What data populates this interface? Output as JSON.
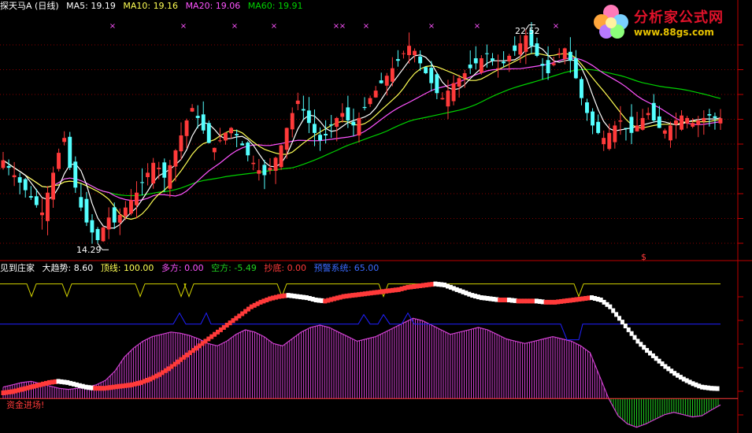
{
  "header": {
    "stock_name": "探天马A (日线)",
    "ma5_label": "MA5:",
    "ma5_value": "19.19",
    "ma10_label": "MA10:",
    "ma10_value": "19.16",
    "ma20_label": "MA20:",
    "ma20_value": "19.06",
    "ma60_label": "MA60:",
    "ma60_value": "19.91"
  },
  "watermark": {
    "cn": "分析家公式网",
    "url": "www.88gs.com"
  },
  "price_panel": {
    "high_label": "22.52",
    "low_label": "14.29",
    "dollar_marker": "$"
  },
  "indicator_header": {
    "name": "见到庄家",
    "trend_label": "大趋势:",
    "trend_value": "8.60",
    "top_label": "顶线:",
    "top_value": "100.00",
    "long_label": "多方:",
    "long_value": "0.00",
    "short_label": "空方:",
    "short_value": "-5.49",
    "bottom_label": "抄底:",
    "bottom_value": "0.00",
    "warn_label": "预警系统:",
    "warn_value": "65.00"
  },
  "indicator_panel": {
    "signal_text": "资金进场!"
  },
  "colors": {
    "up": "#ff3a3a",
    "down": "#54ffff",
    "ma5": "#ffffff",
    "ma10": "#ffff54",
    "ma20": "#ff54ff",
    "ma60": "#00d200",
    "grid": "#c00000",
    "warn": "#2020ff",
    "top": "#d4d400",
    "fund": "#d040d0",
    "neg": "#20d020"
  },
  "chart_data": [
    {
      "type": "candlestick",
      "title": "探天马A (日线)",
      "series": [
        {
          "name": "MA5",
          "last": 19.19
        },
        {
          "name": "MA10",
          "last": 19.16
        },
        {
          "name": "MA20",
          "last": 19.06
        },
        {
          "name": "MA60",
          "last": 19.91
        }
      ],
      "close_path": [
        17.5,
        17.2,
        16.9,
        16.6,
        16.3,
        16.0,
        15.7,
        15.4,
        16.2,
        17.0,
        17.8,
        18.4,
        17.2,
        16.4,
        15.6,
        15.0,
        14.6,
        14.29,
        14.8,
        15.2,
        15.0,
        15.3,
        15.6,
        15.9,
        16.2,
        16.6,
        17.0,
        17.4,
        17.2,
        16.8,
        17.3,
        17.9,
        18.5,
        19.1,
        19.6,
        19.2,
        18.7,
        18.2,
        18.0,
        18.3,
        18.6,
        18.8,
        18.5,
        18.1,
        17.7,
        17.4,
        17.1,
        16.9,
        17.2,
        17.6,
        18.1,
        18.8,
        19.4,
        19.9,
        19.5,
        19.0,
        18.6,
        18.3,
        18.5,
        18.9,
        19.2,
        19.4,
        19.1,
        18.9,
        19.2,
        19.6,
        20.0,
        20.3,
        20.6,
        20.9,
        21.2,
        21.5,
        21.8,
        22.1,
        21.9,
        21.4,
        21.0,
        20.6,
        20.2,
        20.0,
        20.3,
        20.6,
        20.8,
        21.0,
        21.2,
        21.4,
        21.6,
        21.8,
        21.5,
        21.2,
        21.4,
        21.7,
        21.9,
        22.2,
        22.52,
        22.1,
        21.7,
        21.3,
        21.0,
        21.4,
        21.8,
        22.0,
        21.5,
        20.8,
        20.0,
        19.4,
        18.9,
        18.6,
        18.4,
        18.6,
        18.9,
        19.1,
        18.8,
        18.6,
        18.9,
        19.2,
        19.4,
        19.1,
        18.8,
        18.7,
        18.9,
        19.1,
        19.3,
        19.2,
        19.0,
        19.1,
        19.2,
        19.3,
        19.2,
        19.19
      ],
      "high_label": 22.52,
      "low_label": 14.29,
      "ylim": [
        13.5,
        23.5
      ]
    },
    {
      "type": "line",
      "title": "见到庄家",
      "series": [
        {
          "name": "大趋势",
          "last": 8.6
        },
        {
          "name": "顶线",
          "last": 100.0
        },
        {
          "name": "多方",
          "last": 0.0
        },
        {
          "name": "空方",
          "last": -5.49
        },
        {
          "name": "抄底",
          "last": 0.0
        },
        {
          "name": "预警系统",
          "last": 65.0
        }
      ],
      "trend_path": [
        5,
        6,
        8,
        10,
        12,
        14,
        15,
        14,
        12,
        10,
        9,
        9,
        10,
        11,
        12,
        14,
        17,
        21,
        26,
        32,
        38,
        44,
        50,
        56,
        62,
        68,
        74,
        80,
        84,
        87,
        89,
        90,
        89,
        88,
        86,
        85,
        87,
        89,
        90,
        91,
        92,
        93,
        94,
        95,
        97,
        98,
        99,
        100,
        99,
        96,
        93,
        90,
        88,
        87,
        86,
        86,
        85,
        85,
        85,
        84,
        84,
        85,
        86,
        87,
        88,
        86,
        80,
        70,
        60,
        50,
        42,
        35,
        28,
        22,
        17,
        13,
        10,
        9,
        8.6
      ],
      "fund_path": [
        10,
        12,
        14,
        15,
        13,
        11,
        9,
        8,
        9,
        10,
        12,
        16,
        24,
        36,
        44,
        50,
        54,
        56,
        58,
        57,
        55,
        52,
        48,
        46,
        50,
        56,
        60,
        58,
        54,
        48,
        46,
        52,
        58,
        62,
        64,
        62,
        58,
        54,
        50,
        52,
        54,
        58,
        62,
        66,
        70,
        68,
        64,
        60,
        56,
        58,
        60,
        62,
        60,
        56,
        52,
        50,
        48,
        50,
        52,
        54,
        52,
        50,
        46,
        40,
        20,
        0,
        -15,
        -22,
        -25,
        -22,
        -18,
        -14,
        -12,
        -14,
        -16,
        -15,
        -10,
        -5.49
      ],
      "ylim": [
        -30,
        110
      ]
    }
  ]
}
